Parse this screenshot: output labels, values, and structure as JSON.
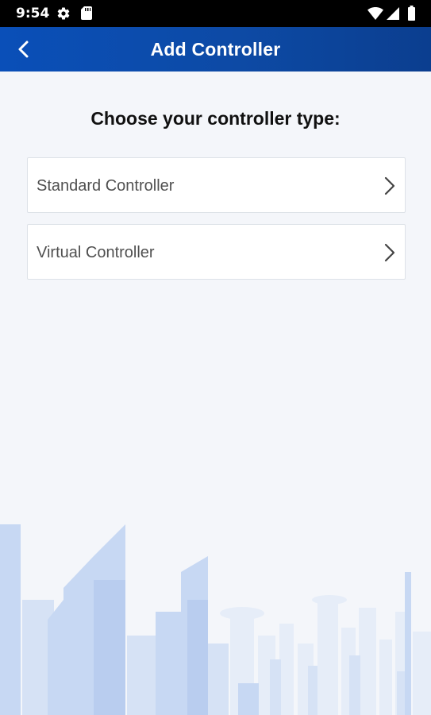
{
  "status_bar": {
    "time": "9:54",
    "icons": [
      "gear-icon",
      "sd-card-icon",
      "wifi-icon",
      "signal-icon",
      "battery-icon"
    ]
  },
  "app_bar": {
    "title": "Add Controller",
    "back_icon": "chevron-left-icon"
  },
  "main": {
    "heading": "Choose your controller type:",
    "options": [
      {
        "label": "Standard Controller",
        "icon": "chevron-right-icon"
      },
      {
        "label": "Virtual Controller",
        "icon": "chevron-right-icon"
      }
    ]
  },
  "colors": {
    "app_bar": "#0d4aa5",
    "background": "#f4f6fa",
    "skyline": "#c7d8f3"
  }
}
